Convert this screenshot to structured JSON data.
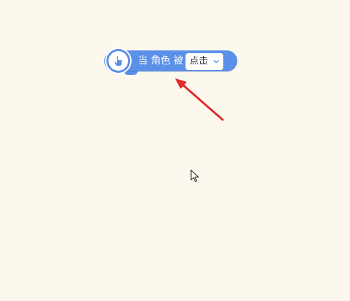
{
  "canvas": {
    "background": "#fdf8ee"
  },
  "event_block": {
    "icon": "pointer-hand-icon",
    "color": "#5b90e8",
    "label_part1": "当 角色 被",
    "dropdown": {
      "selected": "点击",
      "chevron": "chevron-down-icon"
    }
  },
  "annotation": {
    "arrow_color": "#e02a2a",
    "arrow_icon": "red-arrow-icon"
  },
  "cursor": {
    "icon": "mouse-pointer-icon"
  }
}
